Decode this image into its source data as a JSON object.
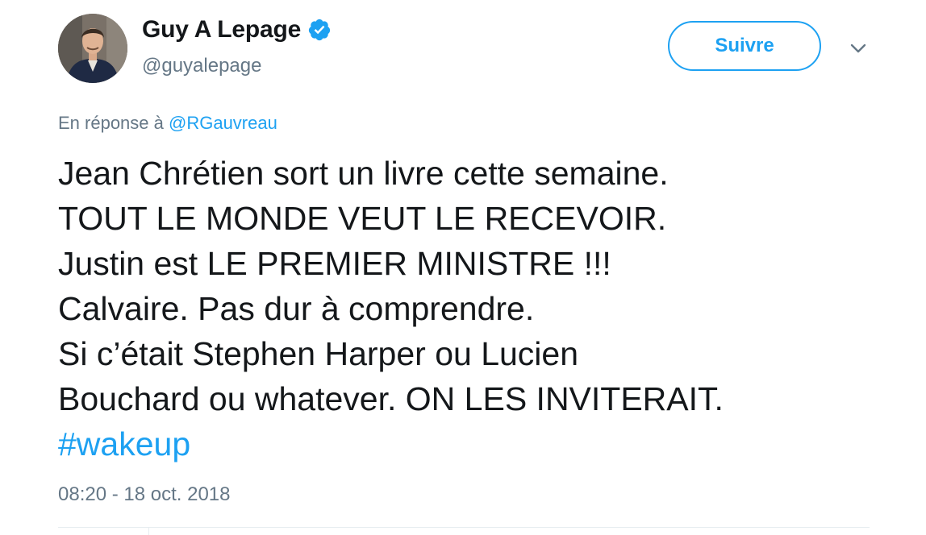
{
  "author": {
    "display_name": "Guy A Lepage",
    "handle": "@guyalepage",
    "verified": true
  },
  "actions": {
    "follow_label": "Suivre"
  },
  "reply": {
    "prefix": "En réponse à",
    "mention": "@RGauvreau"
  },
  "tweet": {
    "lines": [
      "Jean Chrétien sort un livre cette semaine.",
      "TOUT LE MONDE VEUT LE RECEVOIR.",
      "Justin est LE PREMIER MINISTRE !!!",
      "Calvaire. Pas dur à comprendre.",
      "Si c’était Stephen Harper ou Lucien",
      "Bouchard ou whatever. ON LES INVITERAIT."
    ],
    "hashtag": "#wakeup"
  },
  "timestamp": "08:20 - 18 oct. 2018",
  "colors": {
    "accent": "#1da1f2",
    "text": "#14171a",
    "muted": "#657786"
  },
  "icons": {
    "verified": "verified-badge-icon",
    "menu": "chevron-down-icon"
  }
}
